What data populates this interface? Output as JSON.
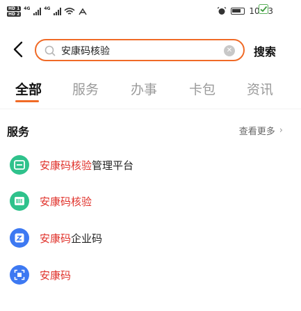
{
  "status_bar": {
    "sim1": "HD 1",
    "sim2": "HD 2",
    "net1": "4G",
    "net2": "4G",
    "time": "10:53"
  },
  "search": {
    "query": "安康码核验",
    "placeholder": "",
    "button_label": "搜索"
  },
  "tabs": [
    {
      "label": "全部",
      "active": true
    },
    {
      "label": "服务",
      "active": false
    },
    {
      "label": "办事",
      "active": false
    },
    {
      "label": "卡包",
      "active": false
    },
    {
      "label": "资讯",
      "active": false
    }
  ],
  "section": {
    "title": "服务",
    "more_label": "查看更多",
    "items": [
      {
        "highlight": "安康码核验",
        "rest": "管理平台",
        "icon": "scan-window-icon",
        "color": "#2fc28c"
      },
      {
        "highlight": "安康码核验",
        "rest": "",
        "icon": "barcode-icon",
        "color": "#2fc28c"
      },
      {
        "highlight": "安康码",
        "rest": "企业码",
        "icon": "code-square-icon",
        "color": "#3d79f2"
      },
      {
        "highlight": "安康码",
        "rest": "",
        "icon": "qr-scan-icon",
        "color": "#3d79f2"
      }
    ]
  },
  "colors": {
    "accent": "#f06a26",
    "highlight": "#e0322b",
    "green_icon": "#2fc28c",
    "blue_icon": "#3d79f2"
  }
}
